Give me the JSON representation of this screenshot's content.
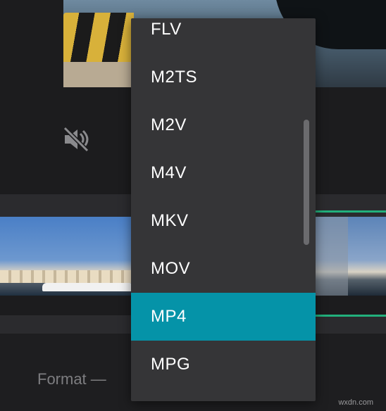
{
  "format_row": {
    "label": "Format —"
  },
  "format_dropdown": {
    "options": [
      "FLV",
      "M2TS",
      "M2V",
      "M4V",
      "MKV",
      "MOV",
      "MP4",
      "MPG"
    ],
    "selected": "MP4"
  },
  "icons": {
    "mute": "volume-mute-icon"
  },
  "colors": {
    "accent_selected": "#0593a8",
    "timeline_marker": "#22b07c",
    "dropdown_bg": "#353537"
  },
  "watermark": "wxdn.com"
}
